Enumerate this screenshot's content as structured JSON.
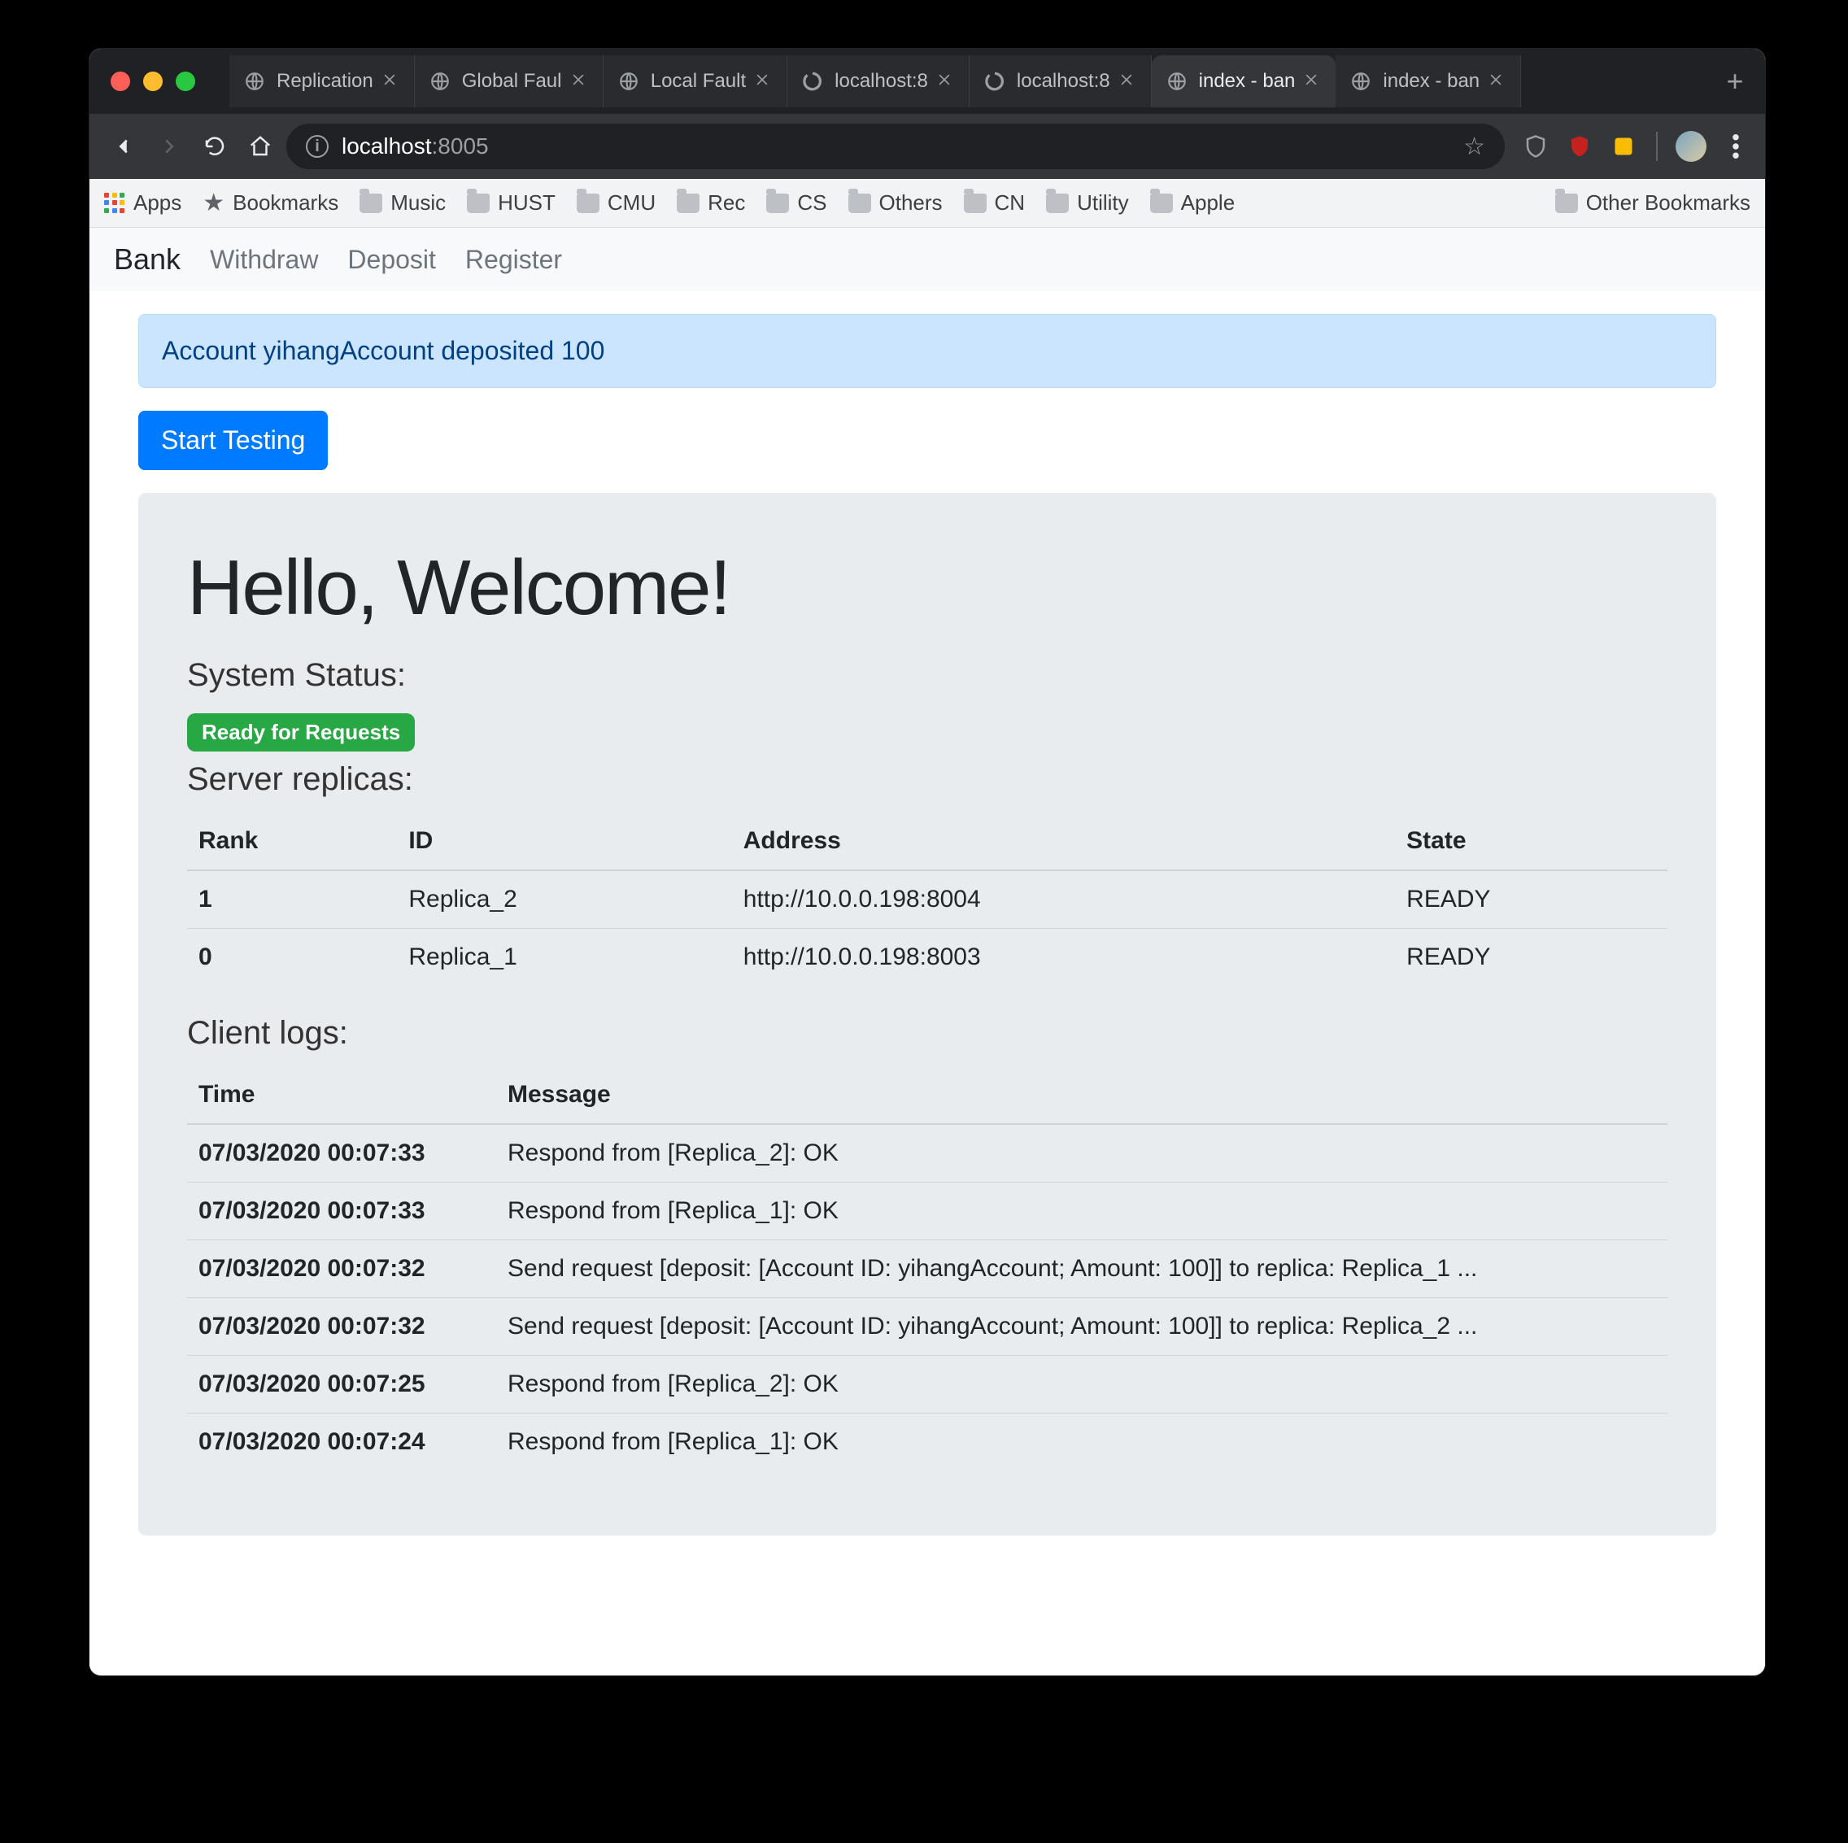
{
  "browser": {
    "tabs": [
      {
        "title": "Replication",
        "favicon": "globe"
      },
      {
        "title": "Global Fault",
        "favicon": "globe"
      },
      {
        "title": "Local Fault",
        "favicon": "globe"
      },
      {
        "title": "localhost:8",
        "favicon": "spinner"
      },
      {
        "title": "localhost:8",
        "favicon": "spinner"
      },
      {
        "title": "index - ban",
        "favicon": "globe",
        "active": true
      },
      {
        "title": "index - ban",
        "favicon": "globe"
      }
    ],
    "url_host": "localhost",
    "url_port": ":8005",
    "bookmarks": [
      "Apps",
      "Bookmarks",
      "Music",
      "HUST",
      "CMU",
      "Rec",
      "CS",
      "Others",
      "CN",
      "Utility",
      "Apple"
    ],
    "other_bookmarks": "Other Bookmarks"
  },
  "nav": {
    "brand": "Bank",
    "items": [
      "Withdraw",
      "Deposit",
      "Register"
    ]
  },
  "alert_text": "Account yihangAccount deposited 100",
  "start_button": "Start Testing",
  "jumbo": {
    "heading": "Hello, Welcome!",
    "status_label": "System Status:",
    "status_badge": "Ready for Requests",
    "replicas_label": "Server replicas:",
    "replica_headers": [
      "Rank",
      "ID",
      "Address",
      "State"
    ],
    "replicas": [
      {
        "rank": "1",
        "id": "Replica_2",
        "addr": "http://10.0.0.198:8004",
        "state": "READY"
      },
      {
        "rank": "0",
        "id": "Replica_1",
        "addr": "http://10.0.0.198:8003",
        "state": "READY"
      }
    ],
    "logs_label": "Client logs:",
    "log_headers": [
      "Time",
      "Message"
    ],
    "logs": [
      {
        "t": "07/03/2020 00:07:33",
        "m": "Respond from [Replica_2]: OK"
      },
      {
        "t": "07/03/2020 00:07:33",
        "m": "Respond from [Replica_1]: OK"
      },
      {
        "t": "07/03/2020 00:07:32",
        "m": "Send request [deposit: [Account ID: yihangAccount; Amount: 100]] to replica: Replica_1 ..."
      },
      {
        "t": "07/03/2020 00:07:32",
        "m": "Send request [deposit: [Account ID: yihangAccount; Amount: 100]] to replica: Replica_2 ..."
      },
      {
        "t": "07/03/2020 00:07:25",
        "m": "Respond from [Replica_2]: OK"
      },
      {
        "t": "07/03/2020 00:07:24",
        "m": "Respond from [Replica_1]: OK"
      }
    ]
  }
}
